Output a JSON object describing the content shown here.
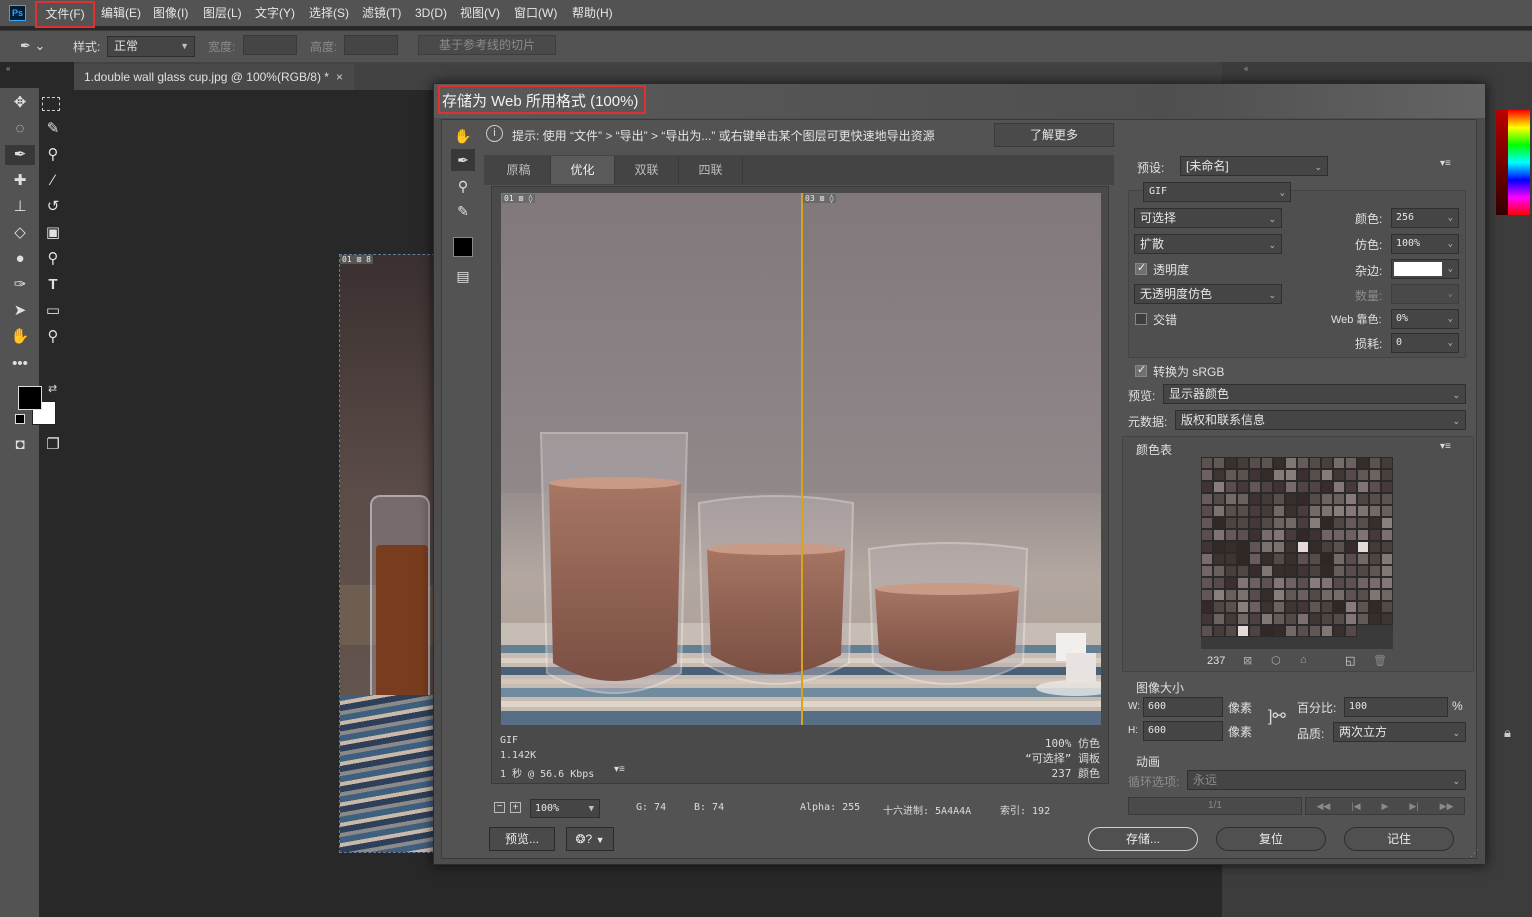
{
  "menubar": {
    "logo": "Ps",
    "items": [
      "文件(F)",
      "编辑(E)",
      "图像(I)",
      "图层(L)",
      "文字(Y)",
      "选择(S)",
      "滤镜(T)",
      "3D(D)",
      "视图(V)",
      "窗口(W)",
      "帮助(H)"
    ]
  },
  "options": {
    "style_label": "样式:",
    "style_value": "正常",
    "width_label": "宽度:",
    "height_label": "高度:",
    "slices_button": "基于参考线的切片"
  },
  "document": {
    "tab_title": "1.double wall glass cup.jpg @ 100%(RGB/8) *",
    "slice_tag": "01"
  },
  "dialog": {
    "title": "存储为 Web 所用格式 (100%)",
    "hint": "提示:  使用 “文件” > “导出” > “导出为...” 或右键单击某个图层可更快速地导出资源",
    "learn_more": "了解更多",
    "tabs": [
      "原稿",
      "优化",
      "双联",
      "四联"
    ],
    "active_tab": "优化",
    "slice_tags": [
      "01",
      "03"
    ],
    "preview_info": {
      "format": "GIF",
      "size": "1.142K",
      "time": "1 秒 @ 56.6 Kbps",
      "dither": "100% 仿色",
      "palette": "“可选择” 调板",
      "colors": "237 颜色"
    },
    "status": {
      "zoom": "100%",
      "g": "G: 74",
      "b": "B: 74",
      "alpha": "Alpha: 255",
      "hex": "十六进制: 5A4A4A",
      "index": "索引: 192"
    },
    "buttons": {
      "preview": "预览...",
      "save": "存储...",
      "reset": "复位",
      "remember": "记住"
    }
  },
  "settings": {
    "preset_label": "预设:",
    "preset_value": "[未命名]",
    "format": "GIF",
    "reduction": "可选择",
    "dither_algo": "扩散",
    "transparency_label": "透明度",
    "transparency_checked": true,
    "matte_dither": "无透明度仿色",
    "interlaced_label": "交错",
    "interlaced_checked": false,
    "colors_label": "颜色:",
    "colors_value": "256",
    "dither_label": "仿色:",
    "dither_value": "100%",
    "matte_label": "杂边:",
    "amount_label": "数量:",
    "web_snap_label": "Web 靠色:",
    "web_snap_value": "0%",
    "lossy_label": "损耗:",
    "lossy_value": "0",
    "convert_srgb_label": "转换为 sRGB",
    "convert_srgb_checked": true,
    "preview_label": "预览:",
    "preview_value": "显示器颜色",
    "metadata_label": "元数据:",
    "metadata_value": "版权和联系信息"
  },
  "color_table": {
    "title": "颜色表",
    "count": "237"
  },
  "image_size": {
    "title": "图像大小",
    "w_label": "W:",
    "w_value": "600",
    "h_label": "H:",
    "h_value": "600",
    "unit": "像素",
    "percent_label": "百分比:",
    "percent_value": "100",
    "percent_unit": "%",
    "quality_label": "品质:",
    "quality_value": "两次立方"
  },
  "animation": {
    "title": "动画",
    "loop_label": "循环选项:",
    "loop_value": "永远",
    "frame": "1/1"
  }
}
